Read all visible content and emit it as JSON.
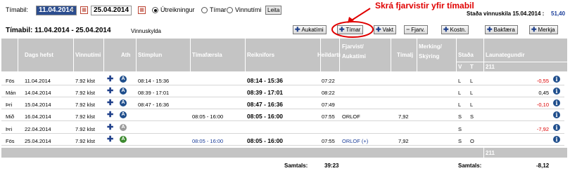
{
  "filter": {
    "label": "Tímabil:",
    "from": "11.04.2014",
    "to": "25.04.2014",
    "options": [
      "Útreikningur",
      "Tímar",
      "Vinnutími"
    ],
    "selected": "Útreikningur",
    "search_label": "Leita"
  },
  "annotation": "Skrá fjarvistir yfir tímabil",
  "balance": {
    "label": "Staða vinnuskila 15.04.2014 :",
    "value": "51,40"
  },
  "period": {
    "title": "Tímabil: 11.04.2014 - 25.04.2014",
    "subtitle": "Vinnuskylda"
  },
  "toolbar": [
    "Aukatími",
    "Tímar",
    "Vakt",
    "Fjarv.",
    "Kostn.",
    "Bakfæra",
    "Merkja"
  ],
  "headers": {
    "date": "Dags hefst",
    "work": "Vinnutími",
    "ath": "Ath",
    "stimp": "Stimplun",
    "timafaersla": "Tímafærsla",
    "reikni": "Reiknifors",
    "heild": "Heildartími",
    "fjarvist": "Fjarvist/ Aukatími",
    "timalj": "Tímalj",
    "merking": "Merking/ Skýring",
    "stada": "Staða",
    "laun": "Launategundir",
    "stada_v": "V",
    "stada_t": "T",
    "laun_code": "211"
  },
  "rows": [
    {
      "day": "Fös",
      "date": "11.04.2014",
      "work": "7.92 klst",
      "icon": "A",
      "icon_color": "#1f4e8c",
      "stimp": "08:14 - 15:36",
      "timaf": "",
      "reikni": "08:14 - 15:36",
      "heild": "07:22",
      "fjarv": "",
      "timalj": "",
      "v": "L",
      "t": "L",
      "laun": "-0,55",
      "laun_neg": true
    },
    {
      "day": "Mán",
      "date": "14.04.2014",
      "work": "7.92 klst",
      "icon": "A",
      "icon_color": "#1f4e8c",
      "stimp": "08:39 - 17:01",
      "timaf": "",
      "reikni": "08:39 - 17:01",
      "heild": "08:22",
      "fjarv": "",
      "timalj": "",
      "v": "L",
      "t": "L",
      "laun": "0,45",
      "laun_neg": false
    },
    {
      "day": "Þri",
      "date": "15.04.2014",
      "work": "7.92 klst",
      "icon": "A",
      "icon_color": "#1f4e8c",
      "stimp": "08:47 - 16:36",
      "timaf": "",
      "reikni": "08:47 - 16:36",
      "heild": "07:49",
      "fjarv": "",
      "timalj": "",
      "v": "L",
      "t": "L",
      "laun": "-0,10",
      "laun_neg": true
    },
    {
      "day": "Mið",
      "date": "16.04.2014",
      "work": "7.92 klst",
      "icon": "A",
      "icon_color": "#1f4e8c",
      "stimp": "",
      "timaf": "08:05 - 16:00",
      "reikni": "08:05 - 16:00",
      "heild": "07:55",
      "fjarv": "ORLOF",
      "timalj": "7,92",
      "v": "S",
      "t": "S",
      "laun": "",
      "laun_neg": false
    },
    {
      "day": "Þri",
      "date": "22.04.2014",
      "work": "7.92 klst",
      "icon": "A",
      "icon_color": "#9a9a9a",
      "stimp": "",
      "timaf": "",
      "reikni": "",
      "heild": "",
      "fjarv": "",
      "timalj": "",
      "v": "S",
      "t": "",
      "laun": "-7,92",
      "laun_neg": true
    },
    {
      "day": "Fös",
      "date": "25.04.2014",
      "work": "7.92 klst",
      "icon": "A",
      "icon_color": "#3c8a2f",
      "stimp": "",
      "timaf": "08:05 - 16:00",
      "reikni": "08:05 - 16:00",
      "heild": "07:55",
      "fjarv": "ORLOF (+)",
      "timalj": "7,92",
      "v": "S",
      "t": "O",
      "laun": "",
      "laun_neg": false
    }
  ],
  "footer": {
    "code": "211"
  },
  "totals": {
    "label1": "Samtals:",
    "value1": "39:23",
    "label2": "Samtals:",
    "value2": "-8,12"
  }
}
